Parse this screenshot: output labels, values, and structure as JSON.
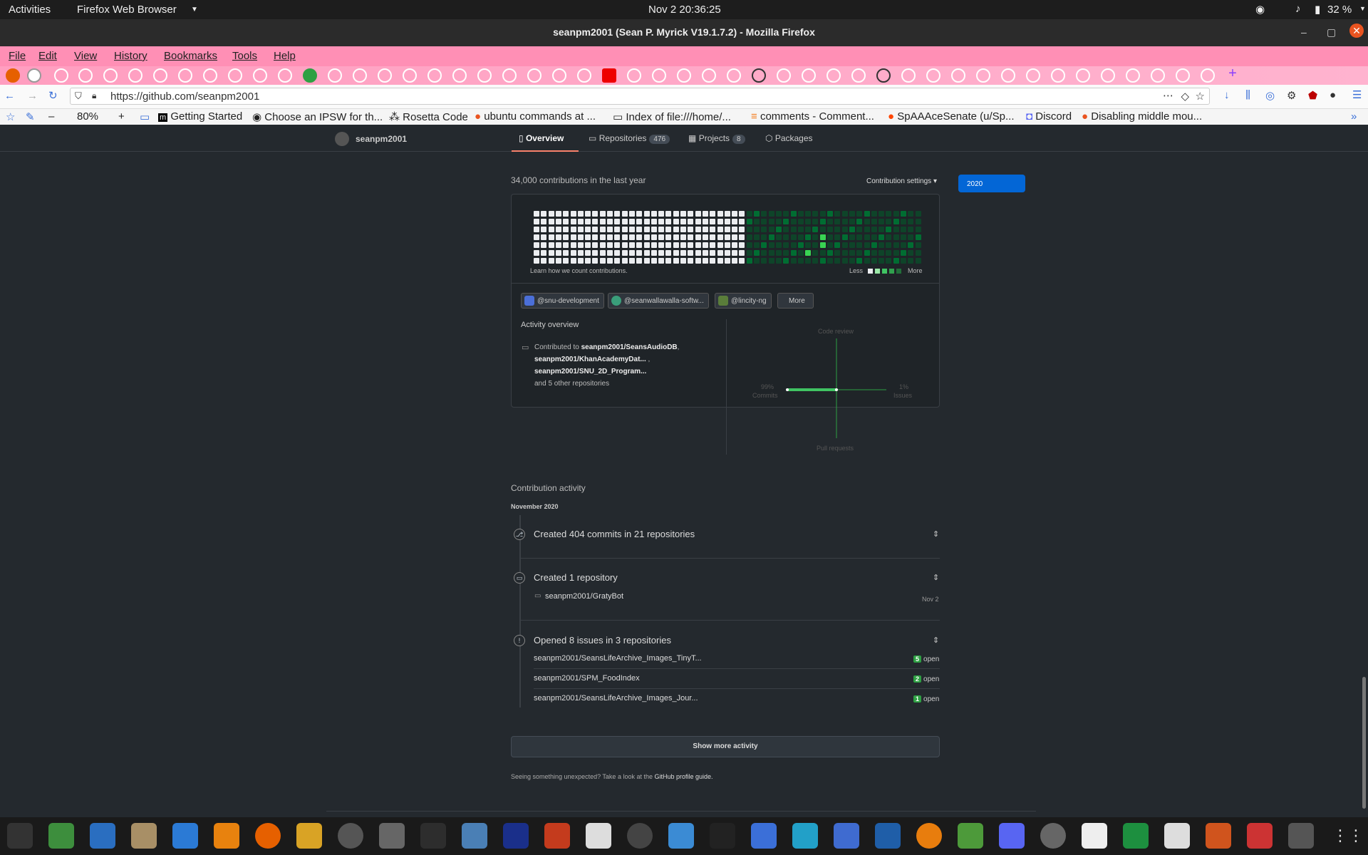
{
  "topbar": {
    "activities": "Activities",
    "app": "Firefox Web Browser",
    "clock": "Nov 2  20:36:25",
    "battery": "32 %"
  },
  "window": {
    "title": "seanpm2001 (Sean P. Myrick V19.1.7.2) - Mozilla Firefox"
  },
  "menu": [
    "File",
    "Edit",
    "View",
    "History",
    "Bookmarks",
    "Tools",
    "Help"
  ],
  "nav": {
    "url": "https://github.com/seanpm2001",
    "zoom": "80%"
  },
  "bookmarks": [
    "Getting Started",
    "Choose an IPSW for th...",
    "Rosetta Code",
    "ubuntu commands at ...",
    "Index of file:///home/...",
    "comments - Comment...",
    "SpAAAceSenate (u/Sp...",
    "Discord",
    "Disabling middle mou..."
  ],
  "profile": {
    "username": "seanpm2001",
    "tabs": [
      {
        "label": "Overview",
        "count": ""
      },
      {
        "label": "Repositories",
        "count": "476"
      },
      {
        "label": "Projects",
        "count": "8"
      },
      {
        "label": "Packages",
        "count": ""
      }
    ]
  },
  "contrib": {
    "heading": "34,000 contributions in the last year",
    "settings": "Contribution settings",
    "year": "2020",
    "learn": "Learn how we count contributions.",
    "less": "Less",
    "more": "More",
    "orgs": [
      "@snu-development",
      "@seanwallawalla-softw...",
      "@lincity-ng"
    ],
    "orgs_more": "More",
    "activity_overview": "Activity overview",
    "contributed_prefix": "Contributed to",
    "repo1": "seanpm2001/SeansAudioDB",
    "repo2": "seanpm2001/KhanAcademyDat...",
    "repo3": "seanpm2001/SNU_2D_Program...",
    "others": "and 5 other repositories",
    "axis_top": "Code review",
    "axis_left_pct": "99%",
    "axis_left": "Commits",
    "axis_right_pct": "1%",
    "axis_right": "Issues",
    "axis_bottom": "Pull requests"
  },
  "activity": {
    "heading": "Contribution activity",
    "month": "November 2020",
    "commits": "Created 404 commits in 21 repositories",
    "created": "Created 1 repository",
    "created_repo": "seanpm2001/GratyBot",
    "created_date": "Nov 2",
    "issues": "Opened 8 issues in 3 repositories",
    "issue_rows": [
      {
        "repo": "seanpm2001/SeansLifeArchive_Images_TinyT...",
        "count": "5",
        "state": "open"
      },
      {
        "repo": "seanpm2001/SPM_FoodIndex",
        "count": "2",
        "state": "open"
      },
      {
        "repo": "seanpm2001/SeansLifeArchive_Images_Jour...",
        "count": "1",
        "state": "open"
      }
    ],
    "show_more": "Show more activity",
    "footer_prefix": "Seeing something unexpected? Take a look at the",
    "footer_link": "GitHub profile guide."
  }
}
